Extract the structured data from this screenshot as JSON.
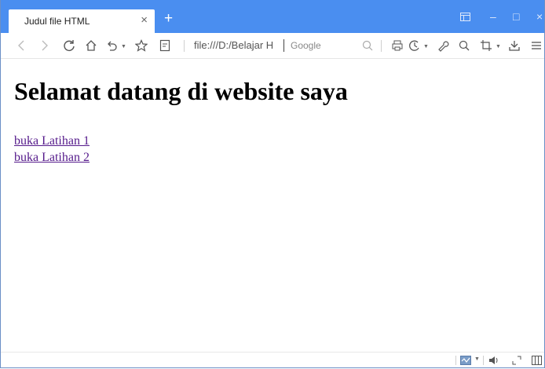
{
  "window": {
    "tab_title": "Judul file HTML",
    "tab_close": "×",
    "new_tab": "+",
    "controls": {
      "restore_icon": "window-layout-icon",
      "minimize": "–",
      "maximize": "□",
      "close": "×"
    }
  },
  "toolbar": {
    "icons": [
      "back-icon",
      "forward-icon",
      "reload-icon",
      "home-icon",
      "undo-icon",
      "favorite-star-icon",
      "reader-icon",
      "print-icon",
      "history-icon",
      "tools-icon",
      "capture-icon",
      "screenshot-icon",
      "download-icon",
      "menu-icon"
    ],
    "address_value": "file:///D:/Belajar H",
    "search_placeholder": "Google"
  },
  "page": {
    "heading": "Selamat datang di website saya",
    "links": [
      "buka Latihan 1",
      "buka Latihan 2"
    ],
    "link_color": "#551a8b"
  },
  "colors": {
    "tabbar": "#4a8ef0",
    "border": "#6b8fc6"
  },
  "statusbar": {
    "icons": [
      "performance-icon",
      "volume-icon",
      "fullscreen-icon",
      "panel-icon"
    ]
  }
}
